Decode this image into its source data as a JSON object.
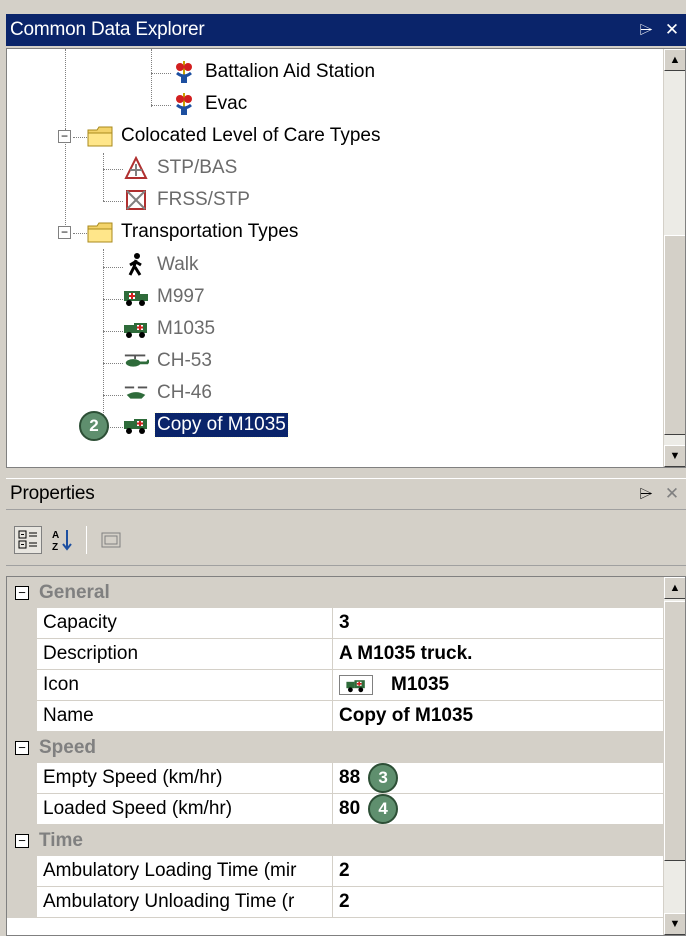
{
  "explorer": {
    "title": "Common Data Explorer",
    "pin_glyph": "⌲",
    "close_glyph": "✕",
    "items": [
      {
        "label": "Battalion Aid Station",
        "icon": "medical-icon"
      },
      {
        "label": "Evac",
        "icon": "medical-icon"
      },
      {
        "label": "Colocated Level of Care Types",
        "icon": "folder-icon"
      },
      {
        "label": "STP/BAS",
        "icon": "care-station-icon"
      },
      {
        "label": "FRSS/STP",
        "icon": "care-station-icon"
      },
      {
        "label": "Transportation Types",
        "icon": "folder-icon"
      },
      {
        "label": "Walk",
        "icon": "walk-icon"
      },
      {
        "label": "M997",
        "icon": "ambulance-icon"
      },
      {
        "label": "M1035",
        "icon": "truck-icon"
      },
      {
        "label": "CH-53",
        "icon": "helicopter-icon"
      },
      {
        "label": "CH-46",
        "icon": "helicopter-icon"
      },
      {
        "label": "Copy of M1035",
        "icon": "truck-icon"
      }
    ],
    "callout": "2"
  },
  "properties": {
    "title": "Properties",
    "pin_glyph": "⌲",
    "close_glyph": "✕",
    "categories": {
      "general": "General",
      "speed": "Speed",
      "time": "Time"
    },
    "rows": {
      "capacity": {
        "name": "Capacity",
        "value": "3"
      },
      "description": {
        "name": "Description",
        "value": "A M1035 truck."
      },
      "icon": {
        "name": "Icon",
        "value": "M1035"
      },
      "name": {
        "name": "Name",
        "value": "Copy of M1035"
      },
      "empty_speed": {
        "name": "Empty Speed (km/hr)",
        "value": "88"
      },
      "loaded_speed": {
        "name": "Loaded Speed (km/hr)",
        "value": "80"
      },
      "amb_loading": {
        "name": "Ambulatory Loading Time (mir",
        "value": "2"
      },
      "amb_unloading": {
        "name": "Ambulatory Unloading Time (r",
        "value": "2"
      }
    },
    "callouts": {
      "empty_speed": "3",
      "loaded_speed": "4"
    }
  },
  "colors": {
    "accent": "#0a246a",
    "badge": "#5f8f6e"
  }
}
